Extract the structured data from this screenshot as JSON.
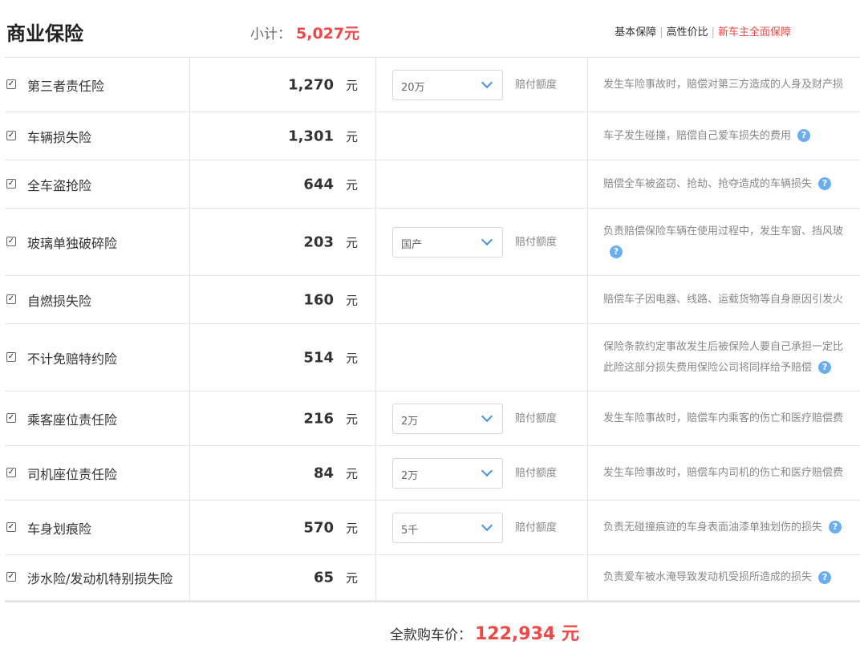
{
  "header": {
    "title": "商业保险",
    "subtotal_label": "小计：",
    "subtotal_value": "5,027元",
    "plans": [
      "基本保障",
      "高性价比",
      "新车主全面保障"
    ]
  },
  "rows": [
    {
      "name": "第三者责任险",
      "price": "1,270",
      "unit": "元",
      "select": "20万",
      "select_label": "赔付额度",
      "desc_lines": [
        "发生车险事故时，赔偿对第三方造成的人身及财产损"
      ],
      "help": false
    },
    {
      "name": "车辆损失险",
      "price": "1,301",
      "unit": "元",
      "select": "",
      "select_label": "",
      "desc_lines": [
        "车子发生碰撞，赔偿自己爱车损失的费用"
      ],
      "help": true
    },
    {
      "name": "全车盗抢险",
      "price": "644",
      "unit": "元",
      "select": "",
      "select_label": "",
      "desc_lines": [
        "赔偿全车被盗窃、抢劫、抢夺造成的车辆损失"
      ],
      "help": true
    },
    {
      "name": "玻璃单独破碎险",
      "price": "203",
      "unit": "元",
      "select": "国产",
      "select_label": "赔付额度",
      "desc_lines": [
        "负责赔偿保险车辆在使用过程中，发生车窗、挡风玻",
        ""
      ],
      "help": true
    },
    {
      "name": "自燃损失险",
      "price": "160",
      "unit": "元",
      "select": "",
      "select_label": "",
      "desc_lines": [
        "赔偿车子因电器、线路、运载货物等自身原因引发火"
      ],
      "help": false
    },
    {
      "name": "不计免赔特约险",
      "price": "514",
      "unit": "元",
      "select": "",
      "select_label": "",
      "desc_lines": [
        "保险条款约定事故发生后被保险人要自己承担一定比",
        "此险这部分损失费用保险公司将同样给予赔偿"
      ],
      "help": true
    },
    {
      "name": "乘客座位责任险",
      "price": "216",
      "unit": "元",
      "select": "2万",
      "select_label": "赔付额度",
      "desc_lines": [
        "发生车险事故时，赔偿车内乘客的伤亡和医疗赔偿费"
      ],
      "help": false
    },
    {
      "name": "司机座位责任险",
      "price": "84",
      "unit": "元",
      "select": "2万",
      "select_label": "赔付额度",
      "desc_lines": [
        "发生车险事故时，赔偿车内司机的伤亡和医疗赔偿费"
      ],
      "help": false
    },
    {
      "name": "车身划痕险",
      "price": "570",
      "unit": "元",
      "select": "5千",
      "select_label": "赔付额度",
      "desc_lines": [
        "负责无碰撞痕迹的车身表面油漆单独划伤的损失"
      ],
      "help": true
    },
    {
      "name": "涉水险/发动机特别损失险",
      "price": "65",
      "unit": "元",
      "select": "",
      "select_label": "",
      "desc_lines": [
        "负责爱车被水淹导致发动机受损所造成的损失"
      ],
      "help": true
    }
  ],
  "footer": {
    "total_label": "全款购车价：",
    "total_value": "122,934 元"
  },
  "icons": {
    "checkbox": "checkbox-checked-icon",
    "help": "question-mark-icon",
    "chevron": "chevron-down-icon"
  },
  "colors": {
    "accent_red": "#f04848",
    "help_blue": "#6aaef0",
    "chevron_blue": "#4a90e2"
  }
}
